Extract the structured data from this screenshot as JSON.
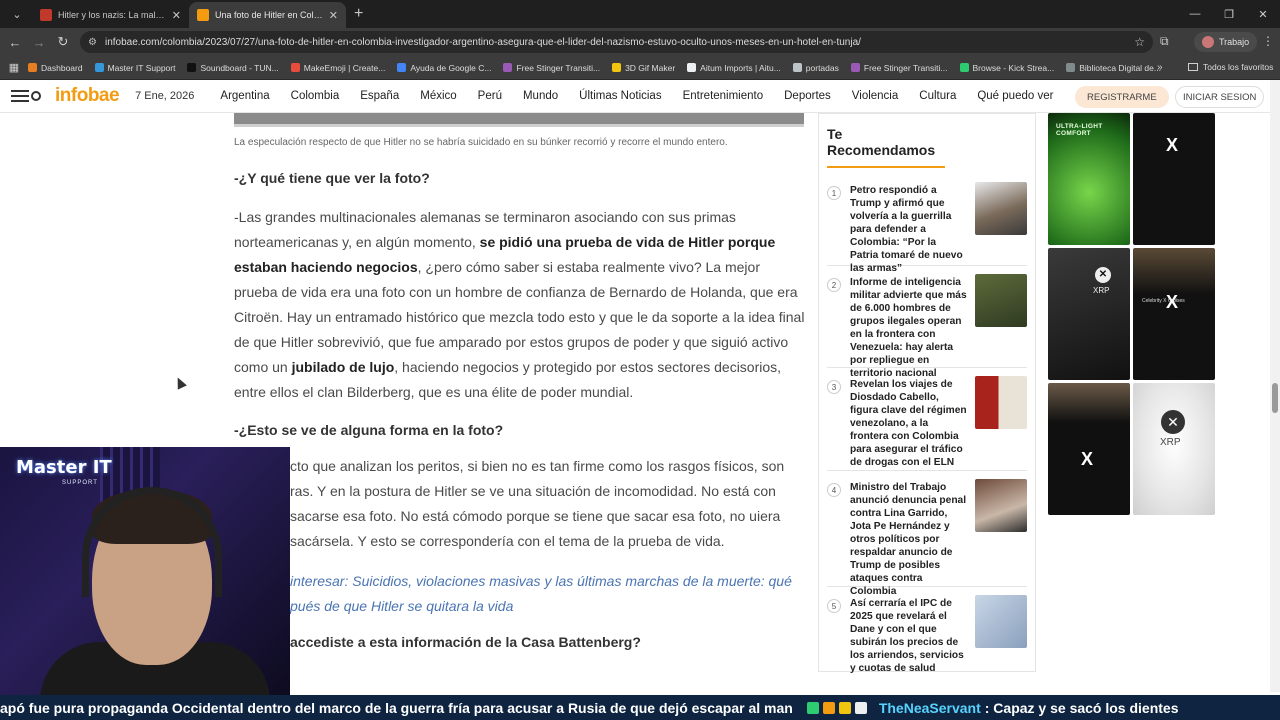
{
  "browser": {
    "tabs": [
      {
        "label": "Hitler y los nazis: La maldad a ju",
        "active": false
      },
      {
        "label": "Una foto de Hitler en Colombia",
        "active": true
      }
    ],
    "url": "infobae.com/colombia/2023/07/27/una-foto-de-hitler-en-colombia-investigador-argentino-asegura-que-el-lider-del-nazismo-estuvo-oculto-unos-meses-en-un-hotel-en-tunja/",
    "profile_label": "Trabajo",
    "bookmarks": [
      "Dashboard",
      "Master IT Support",
      "Soundboard - TUN...",
      "MakeEmoji | Create...",
      "Ayuda de Google C...",
      "Free Stinger Transiti...",
      "3D Gif Maker",
      "Aitum Imports | Aitu...",
      "portadas",
      "Free Stinger Transiti...",
      "Browse - Kick Strea...",
      "Biblioteca Digital de..."
    ],
    "all_bookmarks": "Todos los favoritos"
  },
  "site": {
    "logo": "infobae",
    "date": "7 Ene, 2026",
    "nav": [
      "Argentina",
      "Colombia",
      "España",
      "México",
      "Perú",
      "Mundo",
      "Últimas Noticias",
      "Entretenimiento",
      "Deportes",
      "Violencia",
      "Cultura",
      "Qué puedo ver"
    ],
    "register": "REGISTRARME",
    "login": "INICIAR SESION"
  },
  "article": {
    "caption": "La especulación respecto de que Hitler no se habría suicidado en su búnker recorrió y recorre el mundo entero.",
    "q1": "-¿Y qué tiene que ver la foto?",
    "p1_a": "-Las grandes multinacionales alemanas se terminaron asociando con sus primas norteamericanas y, en algún momento, ",
    "p1_b": "se pidió una prueba de vida de Hitler porque estaban haciendo negocios",
    "p1_c": ", ¿pero cómo saber si estaba realmente vivo? La mejor prueba de vida era una foto con un hombre de confianza de Bernardo de Holanda, que era Citroën. Hay un entramado histórico que mezcla todo esto y que le da soporte a la idea final de que Hitler sobrevivió, que fue amparado por estos grupos de poder y que siguió activo como un ",
    "p1_d": "jubilado de lujo",
    "p1_e": ", haciendo negocios y protegido por estos sectores decisorios, entre ellos el clan Bilderberg, que es una élite de poder mundial.",
    "q2": "-¿Esto se ve de alguna forma en la foto?",
    "p2": "cto que analizan los peritos, si bien no es tan firme como los rasgos físicos, son ras. Y en la postura de Hitler se ve una situación de incomodidad. No está con sacarse esa foto. No está cómodo porque se tiene que sacar esa foto, no uiera sacársela. Y esto se correspondería con el tema de la prueba de vida.",
    "link": "interesar: Suicidios, violaciones masivas y las últimas marchas de la muerte: qué pués de que Hitler se quitara la vida",
    "q3": "accediste a esta información de la Casa Battenberg?"
  },
  "sidebar": {
    "title": "Te Recomendamos",
    "items": [
      {
        "num": "1",
        "text": "Petro respondió a Trump y afirmó que volvería a la guerrilla para defender a Colombia: “Por la Patria tomaré de nuevo las armas”"
      },
      {
        "num": "2",
        "text": "Informe de inteligencia militar advierte que más de 6.000 hombres de grupos ilegales operan en la frontera con Venezuela: hay alerta por repliegue en territorio nacional"
      },
      {
        "num": "3",
        "text": "Revelan los viajes de Diosdado Cabello, figura clave del régimen venezolano, a la frontera con Colombia para asegurar el tráfico de drogas con el ELN"
      },
      {
        "num": "4",
        "text": "Ministro del Trabajo anunció denuncia penal contra Lina Garrido, Jota Pe Hernández y otros políticos por respaldar anuncio de Trump de posibles ataques contra Colombia"
      },
      {
        "num": "5",
        "text": "Así cerraría el IPC de 2025 que revelará el Dane y con el que subirán los precios de los arriendos, servicios y cuotas de salud"
      }
    ]
  },
  "ads": {
    "headline": "ULTRA-LIGHT COMFORT",
    "brand": "XRP",
    "cap_text": "Celebrity X Cruises"
  },
  "webcam": {
    "brand": "Master IT",
    "sub": "SUPPORT"
  },
  "ticker": {
    "text1": "apó fue pura propaganda Occidental dentro del marco de la guerra fría para acusar a Rusia de que dejó escapar al man",
    "user": "TheNeaServant",
    "text2": ":  Capaz y se sacó los dientes"
  },
  "colors": {
    "accent": "#f39c12",
    "ticker_bg": "#0f2440",
    "ticker_user": "#56d3ff",
    "link": "#4a74b3"
  }
}
